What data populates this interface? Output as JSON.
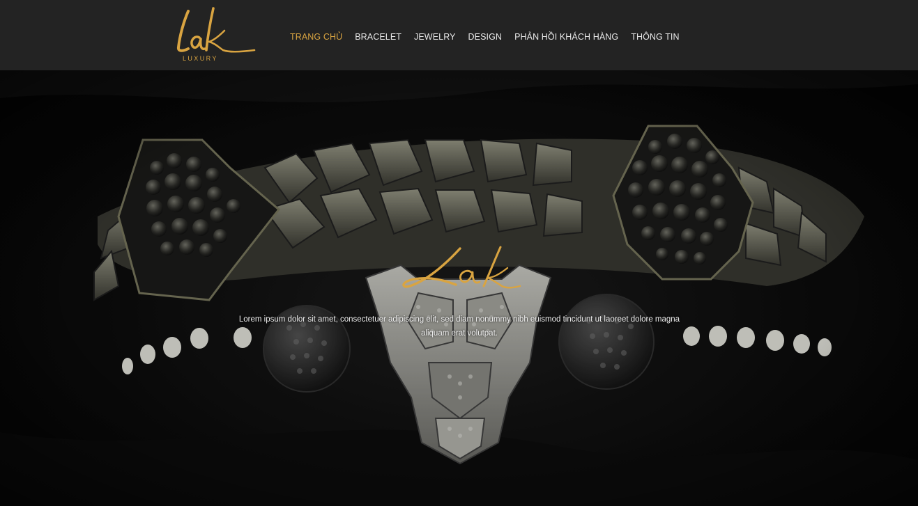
{
  "brand": {
    "logo_script": "Lak",
    "logo_sub": "LUXURY",
    "accent_color": "#d9a441"
  },
  "nav": {
    "items": [
      {
        "label": "TRANG CHỦ",
        "active": true
      },
      {
        "label": "BRACELET",
        "active": false
      },
      {
        "label": "JEWELRY",
        "active": false
      },
      {
        "label": "DESIGN",
        "active": false
      },
      {
        "label": "PHẢN HỒI KHÁCH HÀNG",
        "active": false
      },
      {
        "label": "THÔNG TIN",
        "active": false
      }
    ]
  },
  "hero": {
    "logo_script": "Lak",
    "text": "Lorem ipsum dolor sit amet, consectetuer adipiscing elit, sed diam nonummy nibh euismod tincidunt ut laoreet dolore magna aliquam erat volutpat."
  }
}
